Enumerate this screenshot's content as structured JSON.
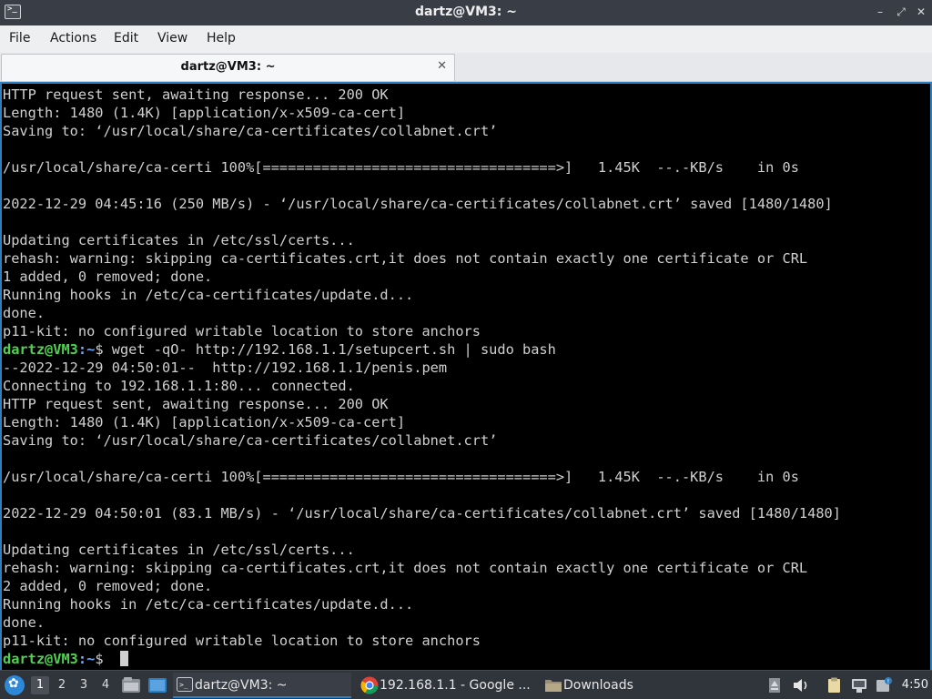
{
  "window": {
    "title": "dartz@VM3: ~",
    "controls": {
      "minimize": "–",
      "restore": "⤢",
      "close": "✕"
    }
  },
  "menu": [
    "File",
    "Actions",
    "Edit",
    "View",
    "Help"
  ],
  "tab": {
    "label": "dartz@VM3: ~",
    "close": "✕"
  },
  "terminal": {
    "prompt_user": "dartz@VM3",
    "prompt_path": ":~",
    "prompt_symbol": "$ ",
    "lines": [
      {
        "text": "HTTP request sent, awaiting response... 200 OK"
      },
      {
        "text": "Length: 1480 (1.4K) [application/x-x509-ca-cert]"
      },
      {
        "text": "Saving to: ‘/usr/local/share/ca-certificates/collabnet.crt’"
      },
      {
        "text": ""
      },
      {
        "text": "/usr/local/share/ca-certi 100%[===================================>]   1.45K  --.-KB/s    in 0s"
      },
      {
        "text": ""
      },
      {
        "text": "2022-12-29 04:45:16 (250 MB/s) - ‘/usr/local/share/ca-certificates/collabnet.crt’ saved [1480/1480]"
      },
      {
        "text": ""
      },
      {
        "text": "Updating certificates in /etc/ssl/certs..."
      },
      {
        "text": "rehash: warning: skipping ca-certificates.crt,it does not contain exactly one certificate or CRL"
      },
      {
        "text": "1 added, 0 removed; done."
      },
      {
        "text": "Running hooks in /etc/ca-certificates/update.d..."
      },
      {
        "text": "done."
      },
      {
        "text": "p11-kit: no configured writable location to store anchors"
      },
      {
        "prompt": true,
        "text": "wget -qO- http://192.168.1.1/setupcert.sh | sudo bash"
      },
      {
        "text": "--2022-12-29 04:50:01--  http://192.168.1.1/penis.pem"
      },
      {
        "text": "Connecting to 192.168.1.1:80... connected."
      },
      {
        "text": "HTTP request sent, awaiting response... 200 OK"
      },
      {
        "text": "Length: 1480 (1.4K) [application/x-x509-ca-cert]"
      },
      {
        "text": "Saving to: ‘/usr/local/share/ca-certificates/collabnet.crt’"
      },
      {
        "text": ""
      },
      {
        "text": "/usr/local/share/ca-certi 100%[===================================>]   1.45K  --.-KB/s    in 0s"
      },
      {
        "text": ""
      },
      {
        "text": "2022-12-29 04:50:01 (83.1 MB/s) - ‘/usr/local/share/ca-certificates/collabnet.crt’ saved [1480/1480]"
      },
      {
        "text": ""
      },
      {
        "text": "Updating certificates in /etc/ssl/certs..."
      },
      {
        "text": "rehash: warning: skipping ca-certificates.crt,it does not contain exactly one certificate or CRL"
      },
      {
        "text": "2 added, 0 removed; done."
      },
      {
        "text": "Running hooks in /etc/ca-certificates/update.d..."
      },
      {
        "text": "done."
      },
      {
        "text": "p11-kit: no configured writable location to store anchors"
      },
      {
        "prompt": true,
        "text": "",
        "cursor": true
      }
    ]
  },
  "taskbar": {
    "workspaces": [
      "1",
      "2",
      "3",
      "4"
    ],
    "active_workspace": "1",
    "tasks": [
      {
        "label": "dartz@VM3: ~",
        "icon": "terminal-icon",
        "active": true
      },
      {
        "label": "192.168.1.1 - Google ...",
        "icon": "chrome-icon",
        "active": false
      },
      {
        "label": "Downloads",
        "icon": "folder-icon",
        "active": false
      }
    ],
    "clock": "4:50"
  },
  "colors": {
    "prompt_user": "#4fd24f",
    "prompt_path": "#6fa8ff",
    "terminal_bg": "#000000",
    "terminal_fg": "#d0d0d0",
    "accent": "#2f7fbf"
  }
}
